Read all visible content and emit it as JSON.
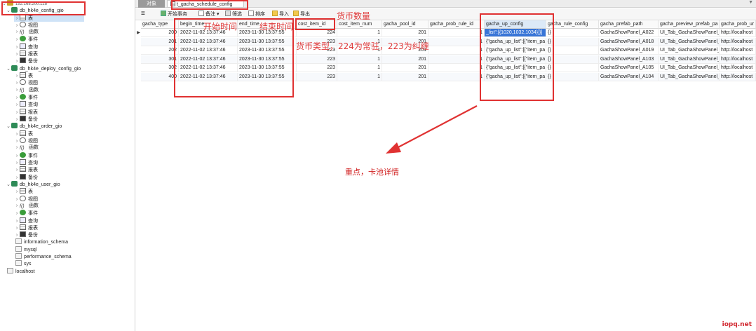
{
  "sidebar": {
    "connection_ip": "192.168.200.128",
    "databases": [
      {
        "name": "db_hk4e_config_gio",
        "items": [
          "表",
          "视图",
          "函数",
          "事件",
          "查询",
          "报表",
          "备份"
        ]
      },
      {
        "name": "db_hk4e_deploy_config_gio",
        "items": [
          "表",
          "视图",
          "函数",
          "事件",
          "查询",
          "报表",
          "备份"
        ]
      },
      {
        "name": "db_hk4e_order_gio",
        "items": [
          "表",
          "视图",
          "函数",
          "事件",
          "查询",
          "报表",
          "备份"
        ]
      },
      {
        "name": "db_hk4e_user_gio",
        "items": [
          "表",
          "视图",
          "函数",
          "事件",
          "查询",
          "报表",
          "备份"
        ]
      }
    ],
    "schemas": [
      "information_schema",
      "mysql",
      "performance_schema",
      "sys"
    ],
    "localhost": "localhost"
  },
  "tabs": {
    "objects": "对象",
    "active": "t_gacha_schedule_config @..."
  },
  "toolbar": {
    "begin_transaction": "开始事务",
    "note": "备注",
    "filter": "筛选",
    "sort": "排序",
    "import": "导入",
    "export": "导出"
  },
  "grid": {
    "columns": [
      "gacha_type",
      "begin_time",
      "end_time",
      "cost_item_id",
      "cost_item_num",
      "gacha_pool_id",
      "gacha_prob_rule_id",
      "gacha_up_config",
      "gacha_rule_config",
      "gacha_prefab_path",
      "gacha_preview_prefab_pa",
      "gacha_prob_ur"
    ],
    "rows": [
      {
        "gacha_type": "200",
        "begin_time": "2022-11-02 13:37:46",
        "end_time": "2023-11-30 13:37:55",
        "cost_item_id": "224",
        "cost_item_num": "1",
        "gacha_pool_id": "201",
        "gacha_prob_rule_id": "1",
        "gacha_up_config": "_list\":[{1020,1032,1034}]}]",
        "gacha_rule_config": "{}",
        "gacha_prefab_path": "GachaShowPanel_A022",
        "gacha_preview_prefab_path": "UI_Tab_GachaShowPanel_",
        "gacha_prob_url": "http://localhost"
      },
      {
        "gacha_type": "201",
        "begin_time": "2022-11-02 13:37:46",
        "end_time": "2023-11-30 13:37:55",
        "cost_item_id": "223",
        "cost_item_num": "1",
        "gacha_pool_id": "201",
        "gacha_prob_rule_id": "1",
        "gacha_up_config": "{\"gacha_up_list\":[{\"item_pa",
        "gacha_rule_config": "{}",
        "gacha_prefab_path": "GachaShowPanel_A018",
        "gacha_preview_prefab_path": "UI_Tab_GachaShowPanel_",
        "gacha_prob_url": "http://localhost"
      },
      {
        "gacha_type": "202",
        "begin_time": "2022-11-02 13:37:46",
        "end_time": "2023-11-30 13:37:55",
        "cost_item_id": "223",
        "cost_item_num": "1",
        "gacha_pool_id": "201",
        "gacha_prob_rule_id": "1",
        "gacha_up_config": "{\"gacha_up_list\":[{\"item_pa",
        "gacha_rule_config": "{}",
        "gacha_prefab_path": "GachaShowPanel_A019",
        "gacha_preview_prefab_path": "UI_Tab_GachaShowPanel_",
        "gacha_prob_url": "http://localhost"
      },
      {
        "gacha_type": "301",
        "begin_time": "2022-11-02 13:37:46",
        "end_time": "2023-11-30 13:37:55",
        "cost_item_id": "223",
        "cost_item_num": "1",
        "gacha_pool_id": "201",
        "gacha_prob_rule_id": "1",
        "gacha_up_config": "{\"gacha_up_list\":[{\"item_pa",
        "gacha_rule_config": "{}",
        "gacha_prefab_path": "GachaShowPanel_A103",
        "gacha_preview_prefab_path": "UI_Tab_GachaShowPanel_",
        "gacha_prob_url": "http://localhost"
      },
      {
        "gacha_type": "302",
        "begin_time": "2022-11-02 13:37:46",
        "end_time": "2023-11-30 13:37:55",
        "cost_item_id": "223",
        "cost_item_num": "1",
        "gacha_pool_id": "201",
        "gacha_prob_rule_id": "1",
        "gacha_up_config": "{\"gacha_up_list\":[{\"item_pa",
        "gacha_rule_config": "{}",
        "gacha_prefab_path": "GachaShowPanel_A105",
        "gacha_preview_prefab_path": "UI_Tab_GachaShowPanel_",
        "gacha_prob_url": "http://localhost"
      },
      {
        "gacha_type": "400",
        "begin_time": "2022-11-02 13:37:46",
        "end_time": "2023-11-30 13:37:55",
        "cost_item_id": "223",
        "cost_item_num": "1",
        "gacha_pool_id": "201",
        "gacha_prob_rule_id": "1",
        "gacha_up_config": "{\"gacha_up_list\":[{\"item_pa",
        "gacha_rule_config": "{}",
        "gacha_prefab_path": "GachaShowPanel_A104",
        "gacha_preview_prefab_path": "UI_Tab_GachaShowPanel_",
        "gacha_prob_url": "http://localhost"
      }
    ]
  },
  "annotations": {
    "begin_time": "开始时间",
    "end_time": "结束时间",
    "currency_amount": "货币数量",
    "currency_type": "货币类型，224为常驻，223为纠缠",
    "focus": "重点，卡池详情"
  },
  "watermark": "iopq.net",
  "colors": {
    "annotation_red": "#e03232",
    "selection_blue": "#3875d7",
    "db_green": "#2e8b57"
  }
}
